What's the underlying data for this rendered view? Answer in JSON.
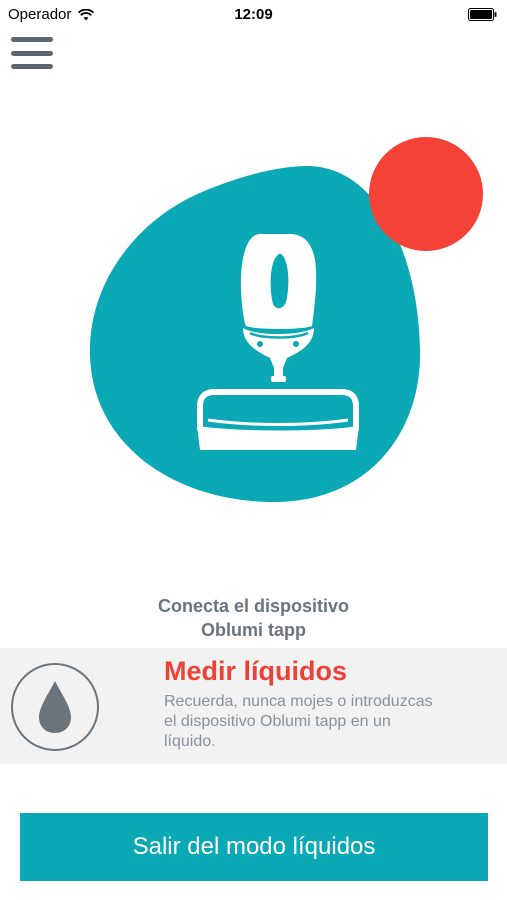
{
  "status_bar": {
    "carrier": "Operador",
    "time": "12:09",
    "wifi_icon": "wifi-icon",
    "battery_icon": "battery-icon"
  },
  "header": {
    "menu_icon": "hamburger-menu-icon"
  },
  "illustration": {
    "blob_color": "#0ba9b6",
    "status_dot_color": "#f44336",
    "device_icon": "oblumi-tapp-device-icon"
  },
  "connect_caption": {
    "line1": "Conecta el dispositivo",
    "line2": "Oblumi tapp"
  },
  "liquid_panel": {
    "icon": "water-drop-icon",
    "title": "Medir líquidos",
    "text_lines": [
      "Recuerda, nunca mojes o introduzcas",
      "el dispositivo Oblumi tapp en un",
      "líquido."
    ],
    "title_color": "#ef4036"
  },
  "exit_button": {
    "label": "Salir del modo líquidos",
    "color": "#0ba9b6"
  }
}
